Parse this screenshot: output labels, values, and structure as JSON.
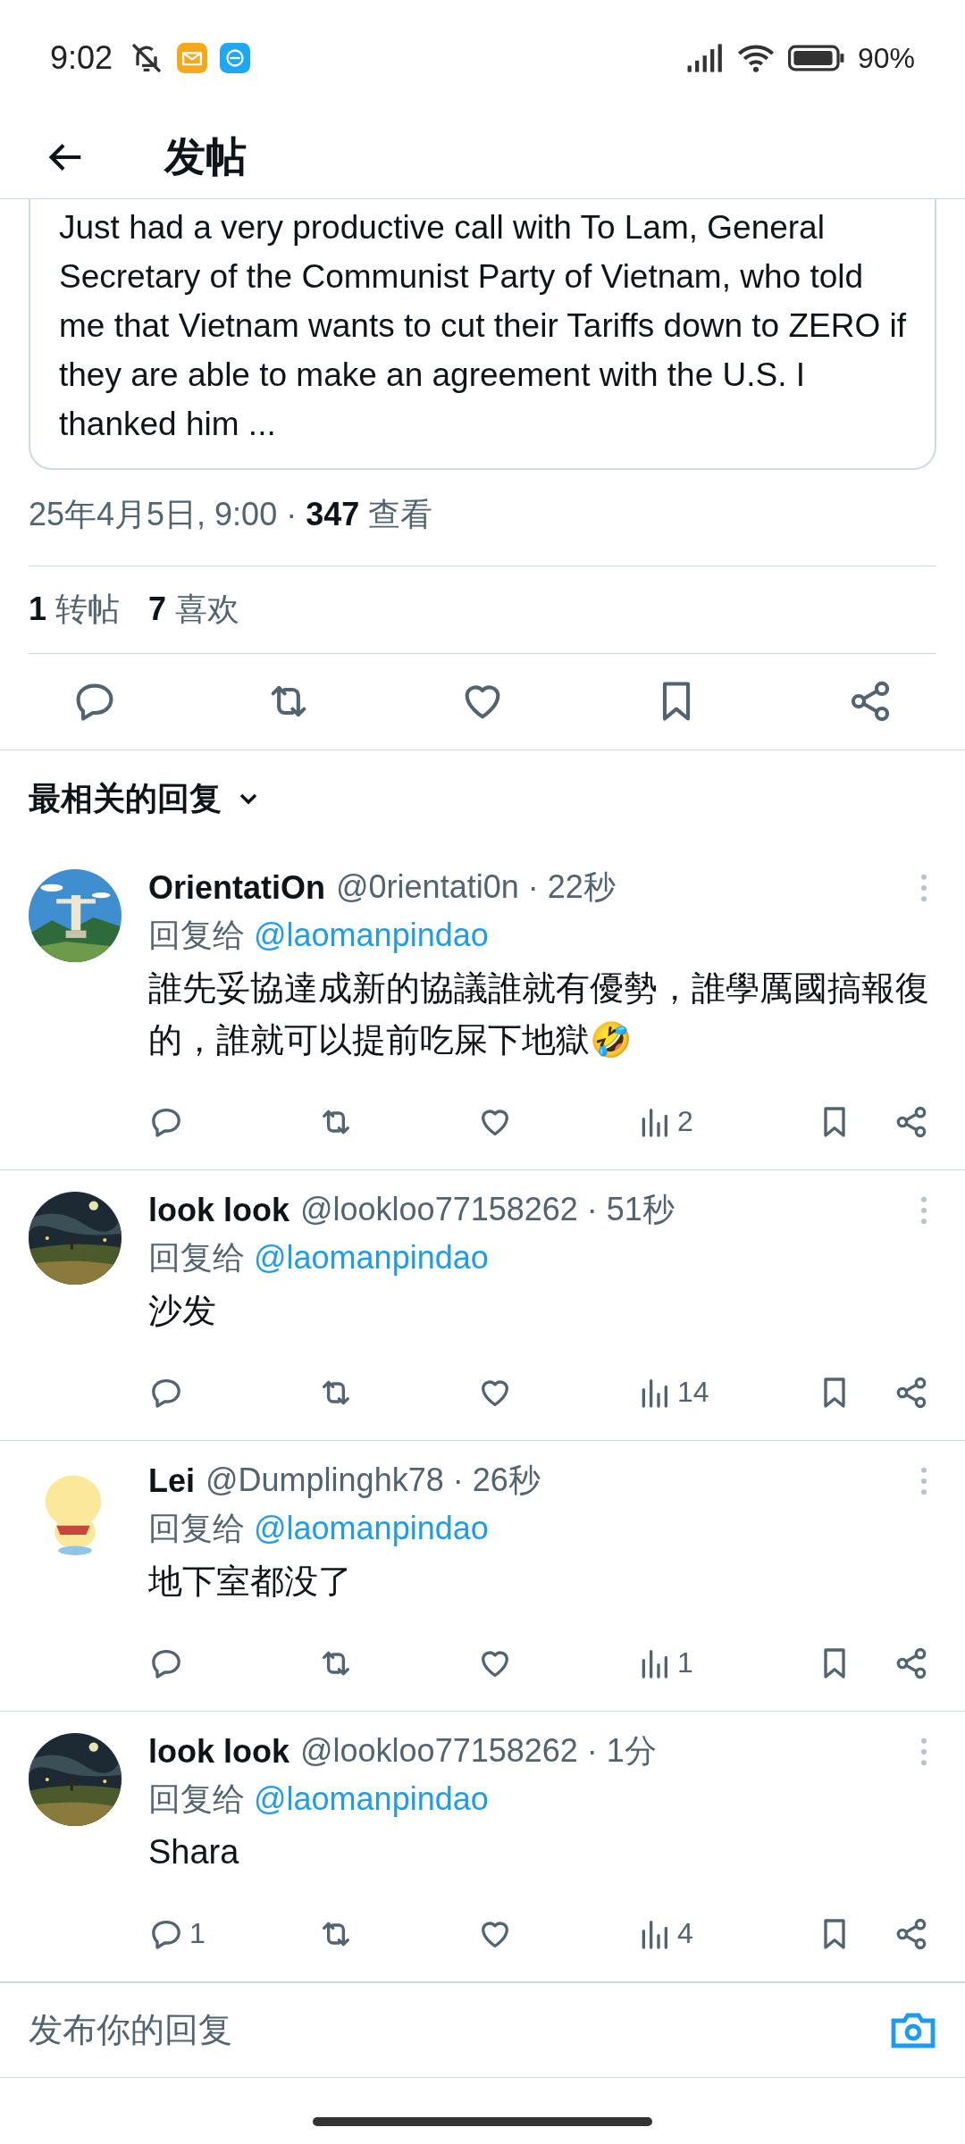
{
  "status_bar": {
    "time": "9:02",
    "battery": "90%"
  },
  "header": {
    "title": "发帖"
  },
  "quoted_post": {
    "text": "Just had a very productive call with To Lam, General Secretary of the Communist Party of Vietnam, who told me that Vietnam wants to cut their Tariffs down to ZERO if they are able to make an agreement with the U.S. I thanked him ..."
  },
  "post_meta": {
    "text": "25年4月5日, 9:00 · **347** 查看"
  },
  "stats": [
    {
      "text": "**1** 转帖"
    },
    {
      "text": "**7** 喜欢"
    }
  ],
  "sort": {
    "label": "最相关的回复"
  },
  "replies": [
    {
      "name": "OrientatiOn",
      "byline": "@0rientati0n · 22秒",
      "reply_to_label": "回复给",
      "reply_to": "@laomanpindao",
      "text": "誰先妥協達成新的協議誰就有優勢，誰學厲國搞報復的，誰就可以提前吃屎下地獄🤣",
      "views": "2"
    },
    {
      "name": "look look",
      "byline": "@lookloo77158262 · 51秒",
      "reply_to_label": "回复给",
      "reply_to": "@laomanpindao",
      "text": "沙发",
      "views": "14"
    },
    {
      "name": "Lei",
      "byline": "@Dumplinghk78 · 26秒",
      "reply_to_label": "回复给",
      "reply_to": "@laomanpindao",
      "text": "地下室都没了",
      "views": "1"
    },
    {
      "name": "look look",
      "byline": "@lookloo77158262 · 1分",
      "reply_to_label": "回复给",
      "reply_to": "@laomanpindao",
      "text": "Shara",
      "replies": "1",
      "views": "4"
    }
  ],
  "composer": {
    "placeholder": "发布你的回复"
  }
}
